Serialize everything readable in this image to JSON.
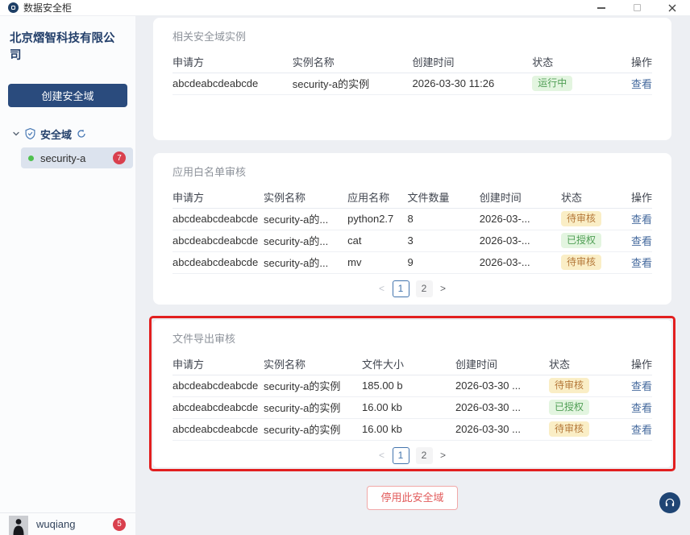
{
  "window": {
    "title": "数据安全柜"
  },
  "sidebar": {
    "company_name": "北京熠智科技有限公司",
    "create_domain_button": "创建安全域",
    "tree_label": "安全域",
    "tree_item": {
      "name": "security-a",
      "badge": "7"
    },
    "user": {
      "name": "wuqiang",
      "badge": "5"
    }
  },
  "sections": [
    {
      "title": "相关安全域实例",
      "headers": [
        "申请方",
        "实例名称",
        "创建时间",
        "状态",
        "操作"
      ],
      "rows": [
        {
          "cells": [
            "abcdeabcdeabcde",
            "security-a的实例",
            "2026-03-30 11:26"
          ],
          "status": {
            "text": "运行中",
            "type": "green"
          },
          "action": "查看"
        }
      ],
      "pagination": null
    },
    {
      "title": "应用白名单审核",
      "headers": [
        "申请方",
        "实例名称",
        "应用名称",
        "文件数量",
        "创建时间",
        "状态",
        "操作"
      ],
      "rows": [
        {
          "cells": [
            "abcdeabcdeabcde",
            "security-a的...",
            "python2.7",
            "8",
            "2026-03-..."
          ],
          "status": {
            "text": "待审核",
            "type": "yellow"
          },
          "action": "查看"
        },
        {
          "cells": [
            "abcdeabcdeabcde",
            "security-a的...",
            "cat",
            "3",
            "2026-03-..."
          ],
          "status": {
            "text": "已授权",
            "type": "green"
          },
          "action": "查看"
        },
        {
          "cells": [
            "abcdeabcdeabcde",
            "security-a的...",
            "mv",
            "9",
            "2026-03-..."
          ],
          "status": {
            "text": "待审核",
            "type": "yellow"
          },
          "action": "查看"
        }
      ],
      "pagination": {
        "prev": "<",
        "pages": [
          "1",
          "2"
        ],
        "active": "1",
        "next": ">"
      }
    },
    {
      "title": "文件导出审核",
      "highlighted": true,
      "headers": [
        "申请方",
        "实例名称",
        "文件大小",
        "创建时间",
        "状态",
        "操作"
      ],
      "rows": [
        {
          "cells": [
            "abcdeabcdeabcde",
            "security-a的实例",
            "185.00 b",
            "2026-03-30 ..."
          ],
          "status": {
            "text": "待审核",
            "type": "yellow"
          },
          "action": "查看"
        },
        {
          "cells": [
            "abcdeabcdeabcde",
            "security-a的实例",
            "16.00 kb",
            "2026-03-30 ..."
          ],
          "status": {
            "text": "已授权",
            "type": "green"
          },
          "action": "查看"
        },
        {
          "cells": [
            "abcdeabcdeabcde",
            "security-a的实例",
            "16.00 kb",
            "2026-03-30 ..."
          ],
          "status": {
            "text": "待审核",
            "type": "yellow"
          },
          "action": "查看"
        }
      ],
      "pagination": {
        "prev": "<",
        "pages": [
          "1",
          "2"
        ],
        "active": "1",
        "next": ">"
      }
    }
  ],
  "footer": {
    "disable_button": "停用此安全域"
  },
  "colors": {
    "accent_navy": "#2a4b7d",
    "highlight_red": "#e21f1f",
    "link_blue": "#44699d",
    "status_green_text": "#4f9e54",
    "status_green_bg": "#e3f5e0",
    "status_yellow_text": "#b5793a",
    "status_yellow_bg": "#faeec6",
    "badge_red": "#d9404e",
    "selected_item_bg": "#dce3ee"
  }
}
